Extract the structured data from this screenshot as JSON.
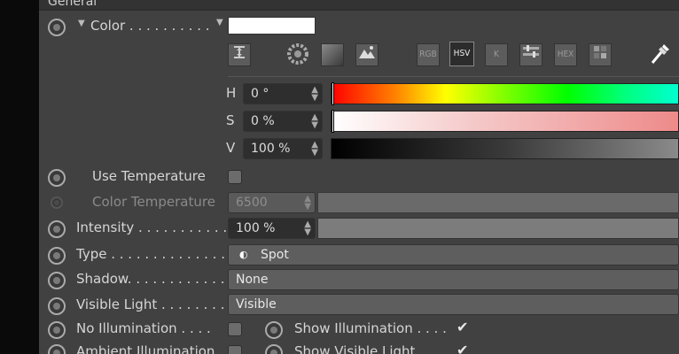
{
  "header": {
    "title": "General"
  },
  "color": {
    "label": "Color . . . . . . . . . .",
    "swatch_color": "#ffffff",
    "modes": [
      {
        "id": "picker",
        "icon": "hourglass-icon"
      },
      {
        "id": "wheel",
        "icon": "color-wheel-icon"
      },
      {
        "id": "spectrum",
        "icon": "spectrum-icon"
      },
      {
        "id": "image",
        "icon": "image-icon"
      },
      {
        "id": "rgb",
        "label": "RGB"
      },
      {
        "id": "hsv",
        "label": "HSV",
        "active": true
      },
      {
        "id": "k",
        "label": "K"
      },
      {
        "id": "mixer",
        "icon": "mixer-icon"
      },
      {
        "id": "hex",
        "label": "HEX"
      },
      {
        "id": "swatches",
        "icon": "swatches-icon"
      }
    ],
    "h": {
      "label": "H",
      "value": "0 °"
    },
    "s": {
      "label": "S",
      "value": "0 %"
    },
    "v": {
      "label": "V",
      "value": "100 %"
    }
  },
  "use_temperature": {
    "label": "Use Temperature"
  },
  "color_temperature": {
    "label": "Color Temperature",
    "value": "6500"
  },
  "intensity": {
    "label": "Intensity . . . . . . . . . . .",
    "value": "100 %"
  },
  "type": {
    "label": "Type . . . . . . . . . . . . . .",
    "value": "Spot"
  },
  "shadow": {
    "label": "Shadow. . . . . . . . . . . .",
    "value": "None"
  },
  "visible_light": {
    "label": "Visible Light . . . . . . . .",
    "value": "Visible"
  },
  "no_illumination": {
    "label": "No Illumination . . . ."
  },
  "show_illumination": {
    "label": "Show Illumination . . . .",
    "checked": true
  },
  "ambient_illumination": {
    "label": "Ambient Illumination"
  },
  "show_visible_light": {
    "label": "Show Visible Light",
    "checked": true
  }
}
